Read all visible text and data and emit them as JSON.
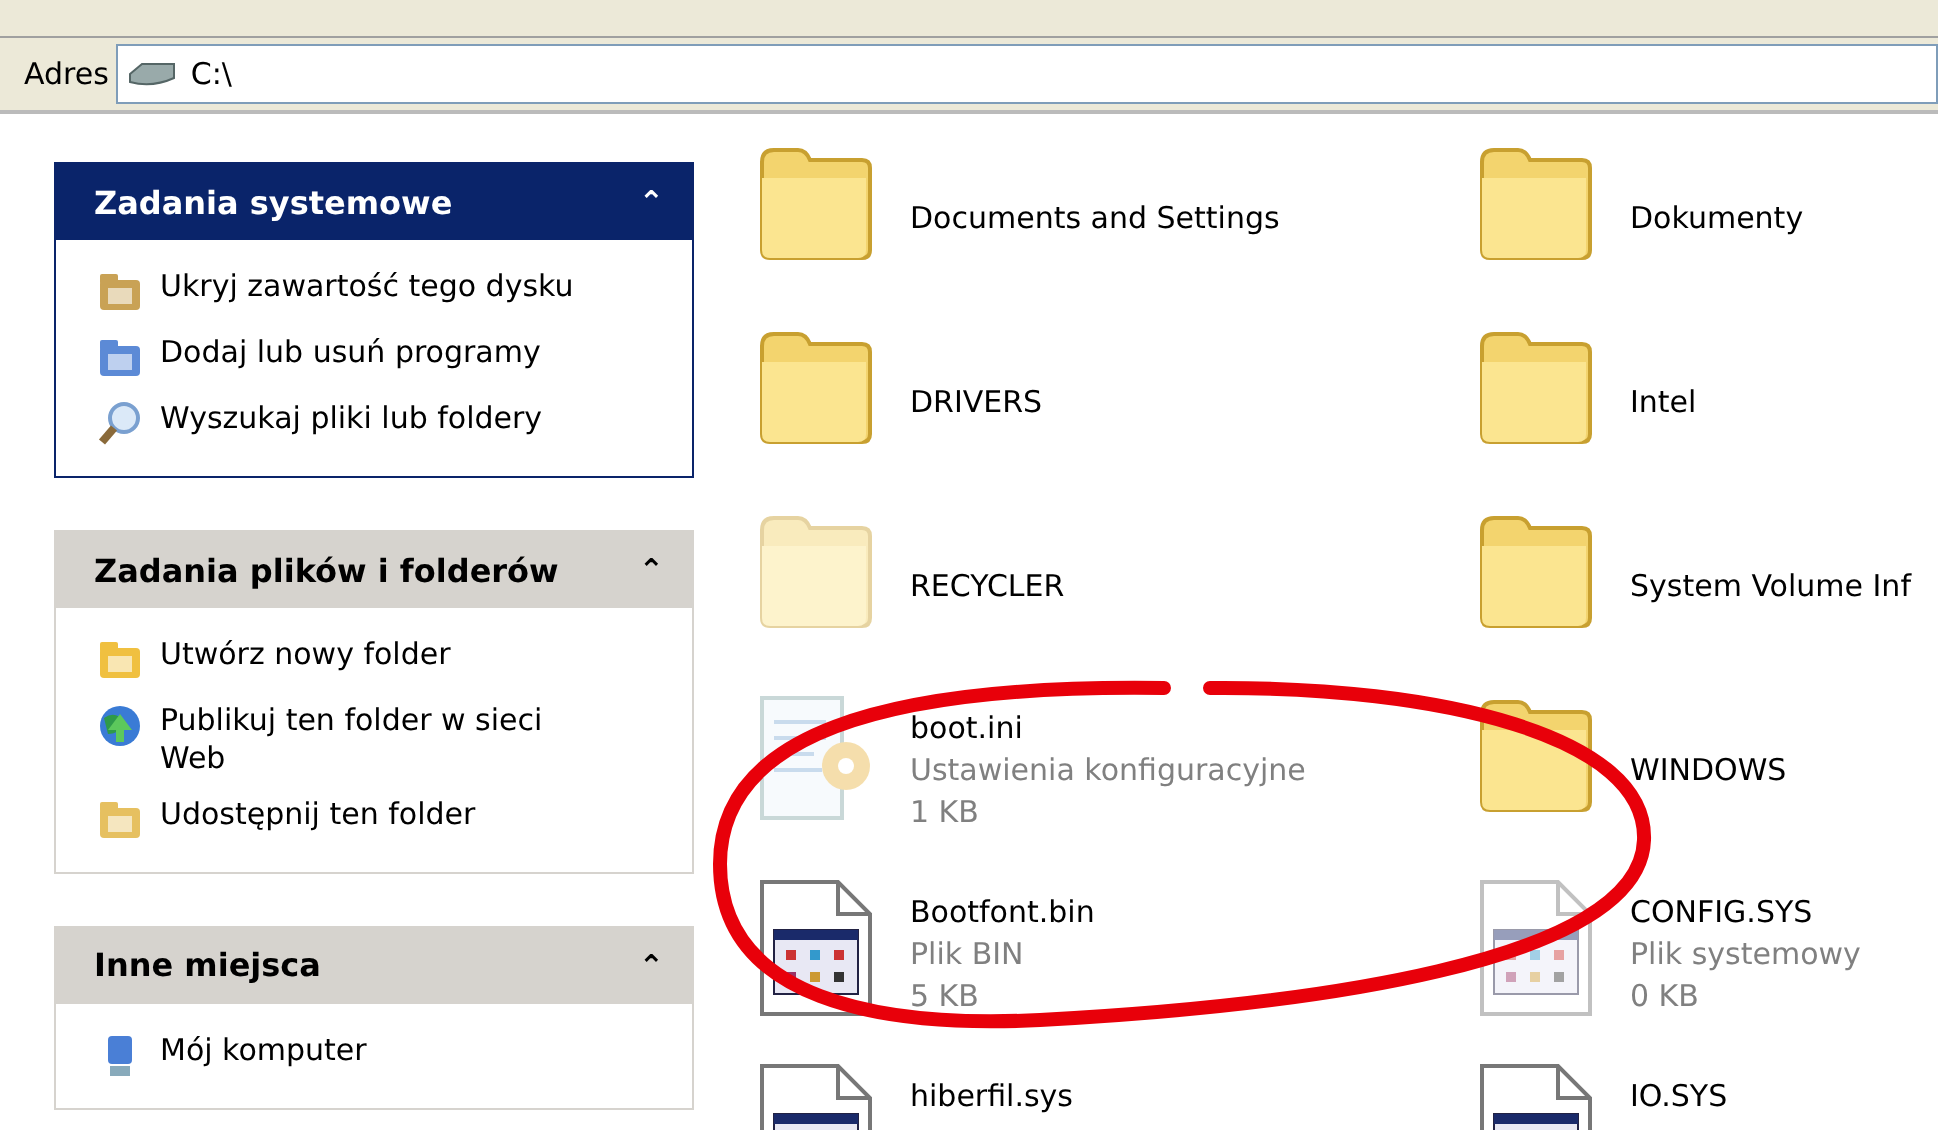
{
  "address_bar": {
    "label": "Adres",
    "value": "C:\\"
  },
  "task_panes": [
    {
      "title": "Zadania systemowe",
      "special": true,
      "collapse_glyph": "⌃",
      "items": [
        {
          "label": "Ukryj zawartość tego dysku"
        },
        {
          "label": "Dodaj lub usuń programy"
        },
        {
          "label": "Wyszukaj pliki lub foldery"
        }
      ]
    },
    {
      "title": "Zadania plików i folderów",
      "special": false,
      "collapse_glyph": "⌃",
      "items": [
        {
          "label": "Utwórz nowy folder"
        },
        {
          "label": "Publikuj ten folder w sieci Web"
        },
        {
          "label": "Udostępnij ten folder"
        }
      ]
    },
    {
      "title": "Inne miejsca",
      "special": false,
      "collapse_glyph": "⌃",
      "items": [
        {
          "label": "Mój komputer"
        }
      ]
    }
  ],
  "files": [
    {
      "kind": "folder",
      "name": "Documents and Settings",
      "hidden": false
    },
    {
      "kind": "folder",
      "name": "Dokumenty",
      "hidden": false
    },
    {
      "kind": "folder",
      "name": "DRIVERS",
      "hidden": false
    },
    {
      "kind": "folder",
      "name": "Intel",
      "hidden": false
    },
    {
      "kind": "folder",
      "name": "RECYCLER",
      "hidden": true
    },
    {
      "kind": "folder",
      "name": "System Volume Inf",
      "hidden": false
    },
    {
      "kind": "settings",
      "name": "boot.ini",
      "hidden": true,
      "details": [
        "Ustawienia konfiguracyjne",
        "1 KB"
      ]
    },
    {
      "kind": "folder",
      "name": "WINDOWS",
      "hidden": false
    },
    {
      "kind": "binary",
      "name": "Bootfont.bin",
      "hidden": false,
      "details": [
        "Plik BIN",
        "5 KB"
      ]
    },
    {
      "kind": "binary",
      "name": "CONFIG.SYS",
      "hidden": true,
      "details": [
        "Plik systemowy",
        "0 KB"
      ]
    },
    {
      "kind": "binary",
      "name": "hiberfil.sys",
      "hidden": false
    },
    {
      "kind": "binary",
      "name": "IO.SYS",
      "hidden": false
    }
  ]
}
